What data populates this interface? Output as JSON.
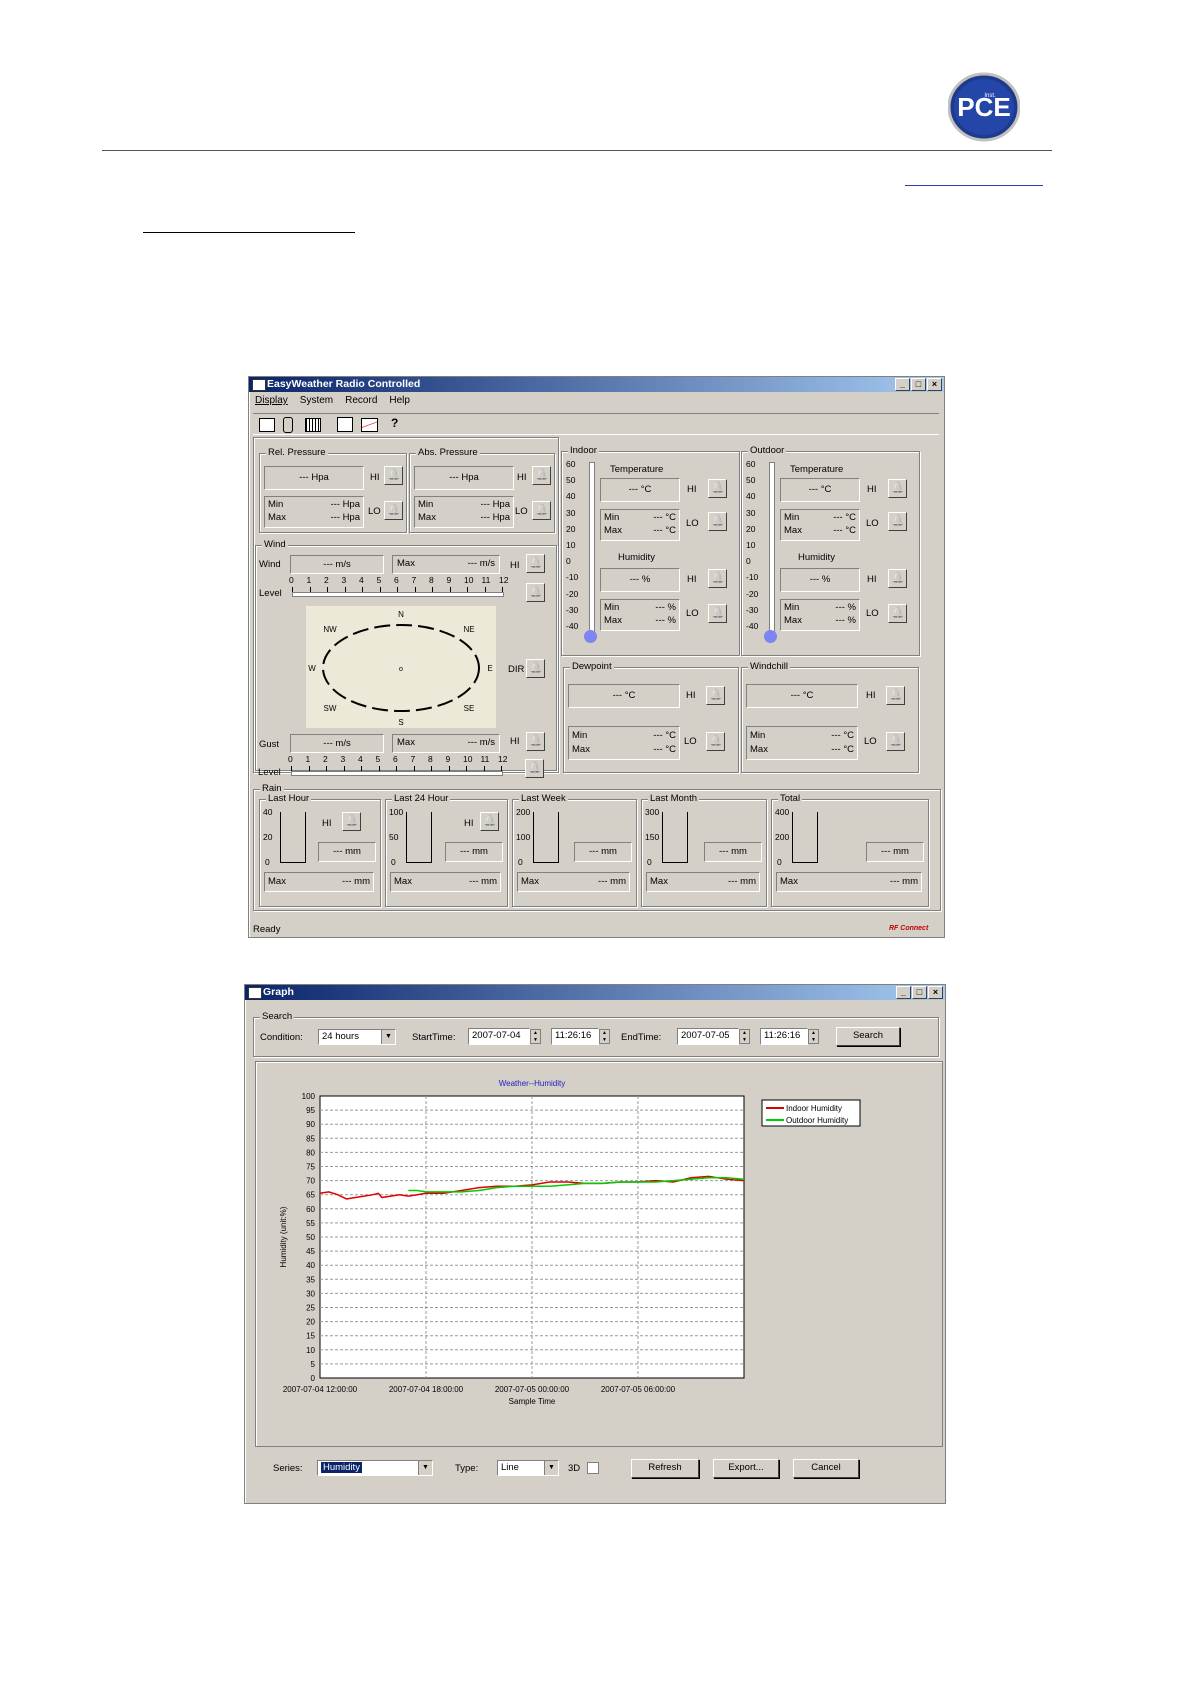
{
  "logo": {
    "text": "PCE",
    "subtext": "Inst."
  },
  "weather": {
    "title": "EasyWeather Radio Controlled",
    "menu": [
      "Display",
      "System",
      "Record",
      "Help"
    ],
    "rel_pressure": {
      "label": "Rel. Pressure",
      "value": "--- Hpa",
      "min": "Min",
      "min_val": "--- Hpa",
      "max": "Max",
      "max_val": "--- Hpa"
    },
    "abs_pressure": {
      "label": "Abs. Pressure",
      "value": "--- Hpa",
      "min": "Min",
      "min_val": "--- Hpa",
      "max": "Max",
      "max_val": "--- Hpa"
    },
    "hi": "HI",
    "lo": "LO",
    "dir": "DIR",
    "wind": {
      "label": "Wind",
      "wind": "Wind",
      "value": "--- m/s",
      "max": "Max",
      "max_val": "--- m/s",
      "level": "Level",
      "gust": "Gust",
      "gust_val": "--- m/s",
      "gust_max_val": "--- m/s"
    },
    "levels": [
      "0",
      "1",
      "2",
      "3",
      "4",
      "5",
      "6",
      "7",
      "8",
      "9",
      "10",
      "11",
      "12"
    ],
    "compass": {
      "N": "N",
      "NE": "NE",
      "E": "E",
      "SE": "SE",
      "S": "S",
      "SW": "SW",
      "W": "W",
      "NW": "NW",
      "center": "o"
    },
    "indoor": {
      "label": "Indoor",
      "temperature": "Temperature",
      "temp_val": "--- °C",
      "min": "Min",
      "max": "Max",
      "tmin": "--- °C",
      "tmax": "--- °C",
      "humidity": "Humidity",
      "hum_val": "--- %",
      "hmin": "--- %",
      "hmax": "--- %"
    },
    "outdoor": {
      "label": "Outdoor",
      "temperature": "Temperature",
      "temp_val": "--- °C",
      "min": "Min",
      "max": "Max",
      "tmin": "--- °C",
      "tmax": "--- °C",
      "humidity": "Humidity",
      "hum_val": "--- %",
      "hmin": "--- %",
      "hmax": "--- %"
    },
    "thermo_scale": [
      "60",
      "50",
      "40",
      "30",
      "20",
      "10",
      "0",
      "-10",
      "-20",
      "-30",
      "-40"
    ],
    "dewpoint": {
      "label": "Dewpoint",
      "value": "--- °C",
      "min": "Min",
      "max": "Max",
      "min_val": "--- °C",
      "max_val": "--- °C"
    },
    "windchill": {
      "label": "Windchill",
      "value": "--- °C",
      "min": "Min",
      "max": "Max",
      "min_val": "--- °C",
      "max_val": "--- °C"
    },
    "rain": {
      "label": "Rain",
      "panels": [
        {
          "label": "Last Hour",
          "scale": [
            "40",
            "20",
            "0"
          ],
          "value": "--- mm",
          "max": "Max",
          "max_val": "--- mm"
        },
        {
          "label": "Last 24 Hour",
          "scale": [
            "100",
            "50",
            "0"
          ],
          "value": "--- mm",
          "max": "Max",
          "max_val": "--- mm"
        },
        {
          "label": "Last Week",
          "scale": [
            "200",
            "100",
            "0"
          ],
          "value": "--- mm",
          "max": "Max",
          "max_val": "--- mm"
        },
        {
          "label": "Last Month",
          "scale": [
            "300",
            "150",
            "0"
          ],
          "value": "--- mm",
          "max": "Max",
          "max_val": "--- mm"
        },
        {
          "label": "Total",
          "scale": [
            "400",
            "200",
            "0"
          ],
          "value": "--- mm",
          "max": "Max",
          "max_val": "--- mm"
        }
      ]
    },
    "status": "Ready",
    "brand": "RF Connect"
  },
  "graph": {
    "title": "Graph",
    "search_group": "Search",
    "condition_label": "Condition:",
    "condition_value": "24 hours",
    "start_label": "StartTime:",
    "start_date": "2007-07-04",
    "start_time": "11:26:16",
    "end_label": "EndTime:",
    "end_date": "2007-07-05",
    "end_time": "11:26:16",
    "search_button": "Search",
    "series_label": "Series:",
    "series_value": "Humidity",
    "type_label": "Type:",
    "type_value": "Line",
    "three_d": "3D",
    "refresh": "Refresh",
    "export": "Export...",
    "cancel": "Cancel"
  },
  "chart_data": {
    "type": "line",
    "title": "Weather--Humidity",
    "xlabel": "Sample Time",
    "ylabel": "Humidity (unit:%)",
    "ylim": [
      0,
      100
    ],
    "yticks": [
      "100",
      "95",
      "90",
      "85",
      "80",
      "75",
      "70",
      "65",
      "60",
      "55",
      "50",
      "45",
      "40",
      "35",
      "30",
      "25",
      "20",
      "15",
      "10",
      "5",
      "0"
    ],
    "xticks": [
      "2007-07-04 12:00:00",
      "2007-07-04 18:00:00",
      "2007-07-05 00:00:00",
      "2007-07-05 06:00:00"
    ],
    "grid": true,
    "legend": "top-right",
    "x_hours": [
      0,
      0.5,
      1,
      1.5,
      2,
      2.5,
      3,
      3.3,
      3.5,
      4,
      4.5,
      5,
      5.5,
      6,
      7,
      8,
      9,
      10,
      11,
      12,
      13,
      14,
      15,
      16,
      17,
      18,
      19,
      20,
      21,
      22,
      23,
      24
    ],
    "series": [
      {
        "name": "Indoor Humidity",
        "color": "#e00000",
        "values": [
          65.5,
          66,
          65,
          63.5,
          64,
          64.5,
          65,
          65.5,
          64,
          64.5,
          65,
          64.5,
          65,
          65.5,
          65.5,
          66.5,
          67.5,
          68,
          68,
          68.5,
          69.5,
          69.5,
          69,
          69,
          69.5,
          69.5,
          70,
          69.5,
          71,
          71.5,
          70.5,
          70
        ]
      },
      {
        "name": "Outdoor Humidity",
        "color": "#00cc00",
        "values": [
          null,
          null,
          null,
          null,
          null,
          null,
          null,
          null,
          null,
          null,
          null,
          66.5,
          66.5,
          66,
          66,
          66,
          66.5,
          67.5,
          68,
          68,
          68,
          68.5,
          69,
          69,
          69.5,
          69.5,
          69.5,
          70,
          70.5,
          71,
          71,
          70.5
        ]
      }
    ]
  }
}
